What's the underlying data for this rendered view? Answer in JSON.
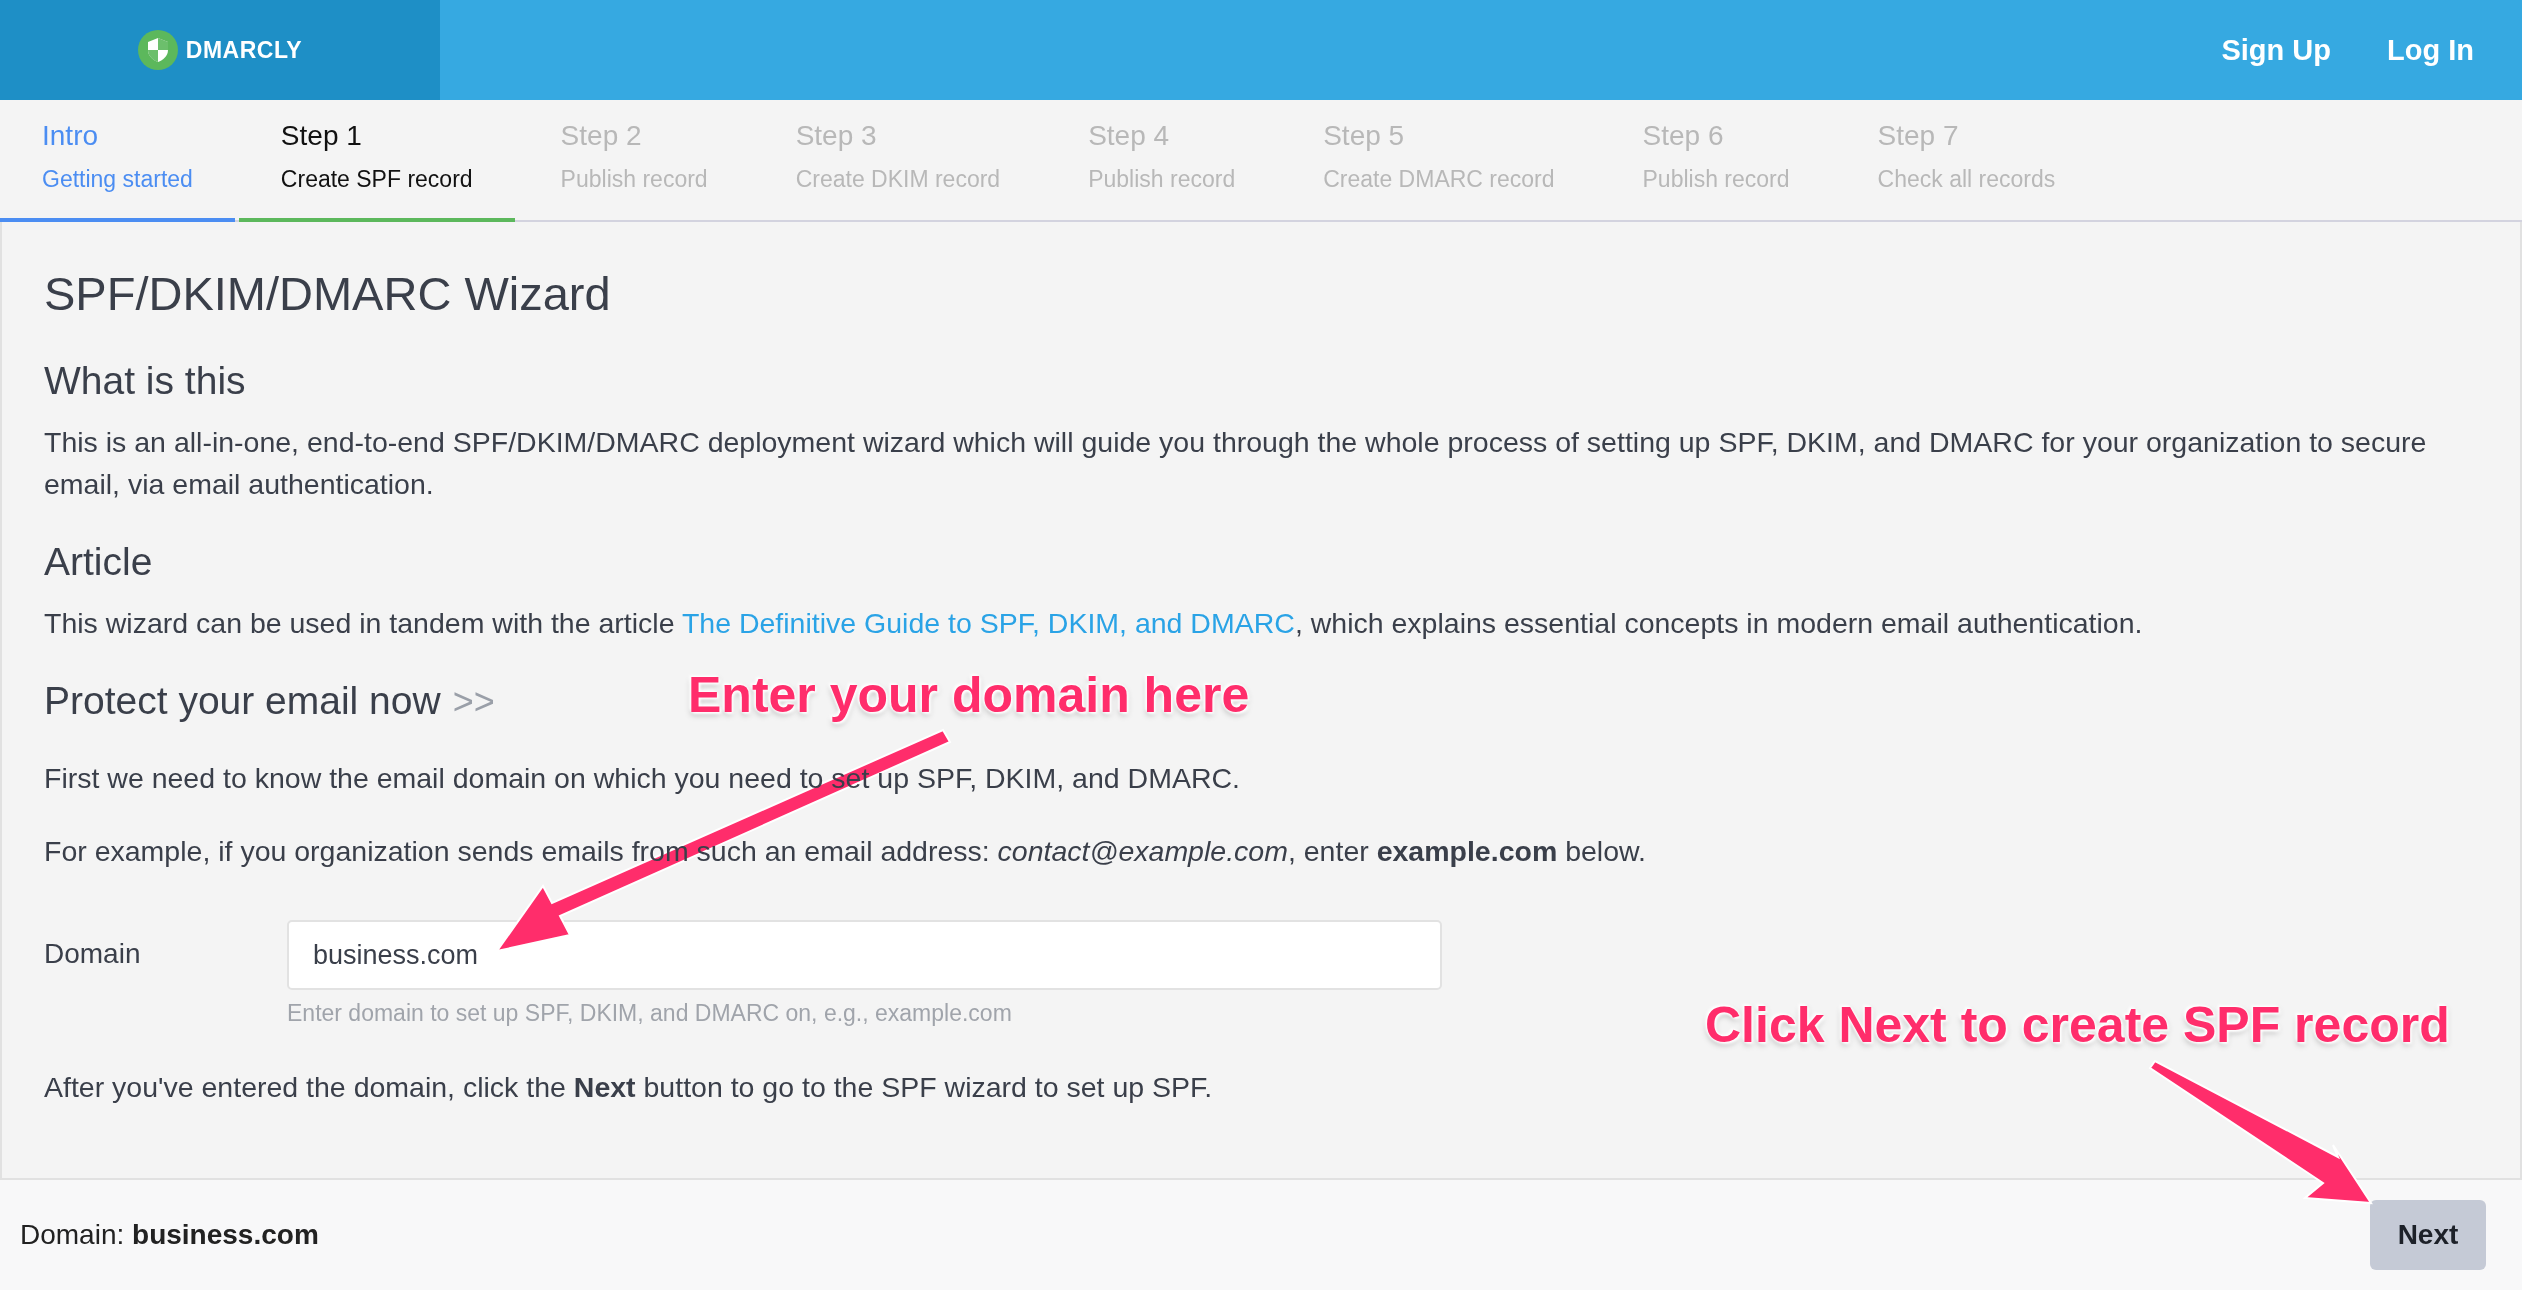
{
  "header": {
    "brand": "DMARCLY",
    "links": [
      "Sign Up",
      "Log In"
    ]
  },
  "tabs": [
    {
      "title": "Intro",
      "subtitle": "Getting started",
      "selected": false,
      "completed": true
    },
    {
      "title": "Step 1",
      "subtitle": "Create SPF record",
      "selected": true,
      "completed": false
    },
    {
      "title": "Step 2",
      "subtitle": "Publish record",
      "selected": false,
      "completed": false
    },
    {
      "title": "Step 3",
      "subtitle": "Create DKIM record",
      "selected": false,
      "completed": false
    },
    {
      "title": "Step 4",
      "subtitle": "Publish record",
      "selected": false,
      "completed": false
    },
    {
      "title": "Step 5",
      "subtitle": "Create DMARC record",
      "selected": false,
      "completed": false
    },
    {
      "title": "Step 6",
      "subtitle": "Publish record",
      "selected": false,
      "completed": false
    },
    {
      "title": "Step 7",
      "subtitle": "Check all records",
      "selected": false,
      "completed": false
    }
  ],
  "main": {
    "title": "SPF/DKIM/DMARC Wizard",
    "what_heading": "What is this",
    "what_text": "This is an all-in-one, end-to-end SPF/DKIM/DMARC deployment wizard which will guide you through the whole process of setting up SPF, DKIM, and DMARC for your organization to secure email, via email authentication.",
    "article_heading": "Article",
    "article_before": "This wizard can be used in tandem with the article ",
    "article_link": "The Definitive Guide to SPF, DKIM, and DMARC",
    "article_after": ", which explains essential concepts in modern email authentication.",
    "protect_heading": "Protect your email now",
    "protect_marker": ">>",
    "intro_text": "First we need to know the email domain on which you need to set up SPF, DKIM, and DMARC.",
    "example_text": "For example, if you organization sends emails from such an email address: *contact@example.com*, enter **example.com** below.",
    "domain_field": {
      "label": "Domain",
      "value": "business.com",
      "help": "Enter domain to set up SPF, DKIM, and DMARC on, e.g., example.com"
    },
    "after_text": "After you've entered the domain, click the **Next** button to go to the SPF wizard to set up SPF."
  },
  "footer": {
    "summary": "Domain: **business.com**",
    "next_button": "Next"
  },
  "annotations": [
    "Enter your domain here",
    "Click Next to create SPF record"
  ]
}
